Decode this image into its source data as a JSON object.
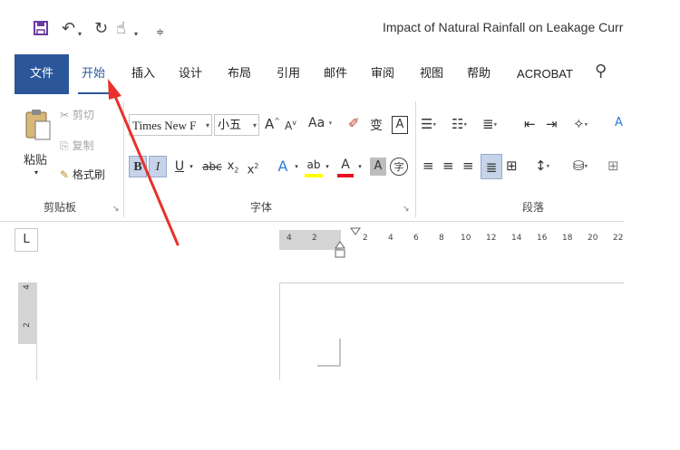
{
  "title": "Impact of Natural Rainfall on Leakage Curre",
  "qat": {
    "save": "save-icon",
    "undo": "undo-icon",
    "redo": "redo-icon",
    "touch": "touch-mode-icon",
    "customize": "customize-qat-icon"
  },
  "tabs": [
    "文件",
    "开始",
    "插入",
    "设计",
    "布局",
    "引用",
    "邮件",
    "审阅",
    "视图",
    "帮助",
    "ACROBAT"
  ],
  "clipboard": {
    "paste": "粘贴",
    "cut": "剪切",
    "copy": "复制",
    "format_painter": "格式刷",
    "group": "剪贴板"
  },
  "font": {
    "name": "Times New F",
    "size": "小五",
    "grow": "A",
    "shrink": "A",
    "case": "Aa",
    "phonetic": "变",
    "charborder": "A",
    "bold": "B",
    "italic": "I",
    "underline": "U",
    "strike": "abc",
    "sub": "x",
    "sub_mark": "2",
    "sup": "x",
    "sup_mark": "2",
    "effects": "A",
    "highlight": "ab",
    "color": "A",
    "shade": "A",
    "enclose": "字",
    "group": "字体"
  },
  "paragraph": {
    "group": "段落"
  },
  "ruler": {
    "corner": "L",
    "ticks": [
      "4",
      "2",
      "2",
      "4",
      "6",
      "8",
      "10",
      "12",
      "14",
      "16",
      "18",
      "20",
      "22"
    ],
    "vticks": [
      "4",
      "2"
    ]
  },
  "colors": {
    "brand": "#2b579a",
    "arrow": "#e8312a",
    "highlight": "#ffff00",
    "fontcolor": "#e81123"
  }
}
